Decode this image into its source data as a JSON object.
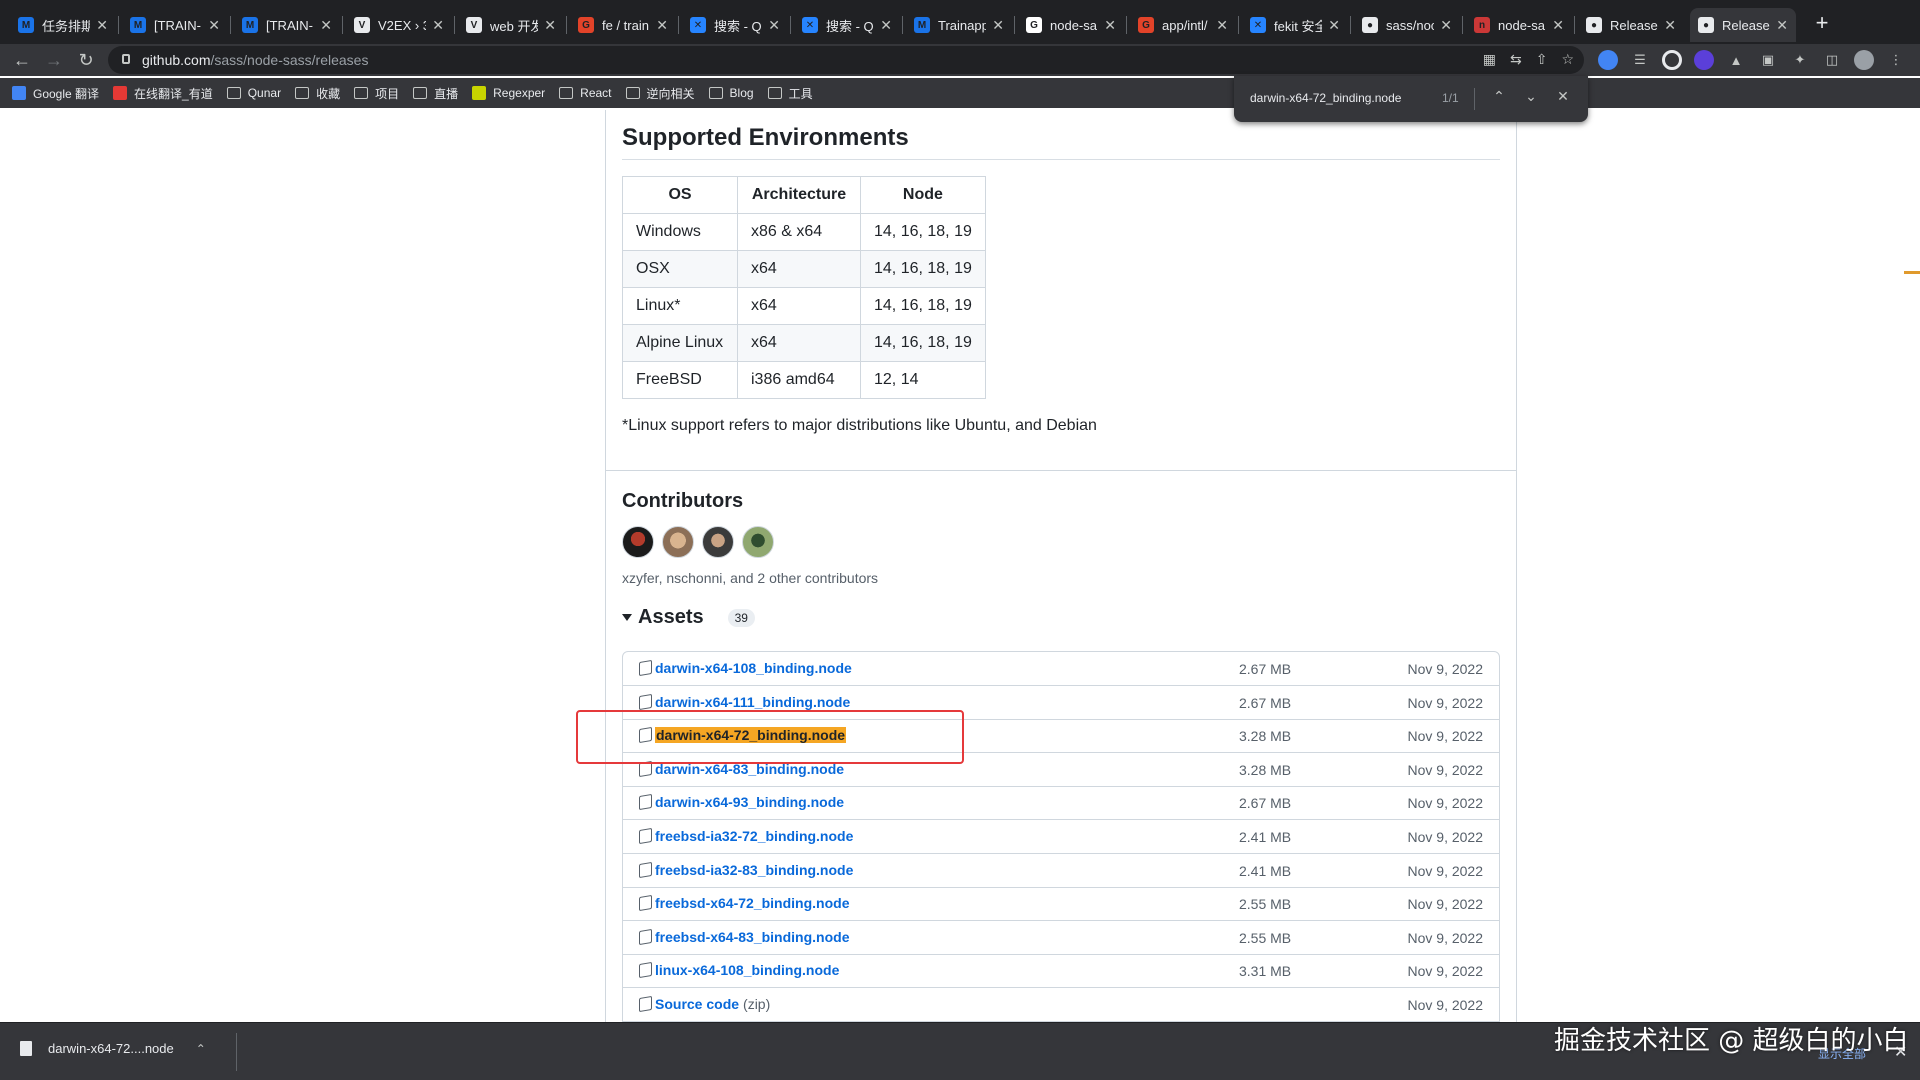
{
  "browser": {
    "tabs": [
      {
        "title": "任务排期",
        "color": "#1a73e8",
        "glyph": "M"
      },
      {
        "title": "[TRAIN-",
        "color": "#1a73e8",
        "glyph": "M"
      },
      {
        "title": "[TRAIN-",
        "color": "#1a73e8",
        "glyph": "M"
      },
      {
        "title": "V2EX › 3",
        "color": "#e8eaed",
        "glyph": "V"
      },
      {
        "title": "web 开发",
        "color": "#e8eaed",
        "glyph": "V"
      },
      {
        "title": "fe / train",
        "color": "#e24329",
        "glyph": "G"
      },
      {
        "title": "搜索 - Q",
        "color": "#2684ff",
        "glyph": "✕"
      },
      {
        "title": "搜索 - Q",
        "color": "#2684ff",
        "glyph": "✕"
      },
      {
        "title": "Trainapp",
        "color": "#1a73e8",
        "glyph": "M"
      },
      {
        "title": "node-sa",
        "color": "#ffffff",
        "glyph": "G"
      },
      {
        "title": "app/intl/",
        "color": "#e24329",
        "glyph": "G"
      },
      {
        "title": "fekit 安全",
        "color": "#2684ff",
        "glyph": "✕"
      },
      {
        "title": "sass/noc",
        "color": "#e8eaed",
        "glyph": "●"
      },
      {
        "title": "node-sa",
        "color": "#cb3837",
        "glyph": "n"
      },
      {
        "title": "Release",
        "color": "#e8eaed",
        "glyph": "●"
      },
      {
        "title": "Release",
        "color": "#e8eaed",
        "glyph": "●"
      }
    ],
    "url_host": "github.com",
    "url_path": "/sass/node-sass/releases",
    "bookmarks": [
      "Google 翻译",
      "在线翻译_有道",
      "Qunar",
      "收藏",
      "项目",
      "直播",
      "Regexper",
      "React",
      "逆向相关",
      "Blog",
      "工具"
    ],
    "find_query": "darwin-x64-72_binding.node",
    "find_count": "1/1"
  },
  "supported": {
    "title": "Supported Environments",
    "headers": [
      "OS",
      "Architecture",
      "Node"
    ],
    "rows": [
      [
        "Windows",
        "x86 & x64",
        "14, 16, 18, 19"
      ],
      [
        "OSX",
        "x64",
        "14, 16, 18, 19"
      ],
      [
        "Linux*",
        "x64",
        "14, 16, 18, 19"
      ],
      [
        "Alpine Linux",
        "x64",
        "14, 16, 18, 19"
      ],
      [
        "FreeBSD",
        "i386 amd64",
        "12, 14"
      ]
    ],
    "note": "*Linux support refers to major distributions like Ubuntu, and Debian"
  },
  "contributors": {
    "title": "Contributors",
    "text": "xzyfer, nschonni, and 2 other contributors"
  },
  "assets": {
    "title": "Assets",
    "count": "39",
    "items": [
      {
        "name": "darwin-x64-108_binding.node",
        "size": "2.67 MB",
        "date": "Nov 9, 2022"
      },
      {
        "name": "darwin-x64-111_binding.node",
        "size": "2.67 MB",
        "date": "Nov 9, 2022"
      },
      {
        "name": "darwin-x64-72_binding.node",
        "size": "3.28 MB",
        "date": "Nov 9, 2022",
        "highlight": true
      },
      {
        "name": "darwin-x64-83_binding.node",
        "size": "3.28 MB",
        "date": "Nov 9, 2022"
      },
      {
        "name": "darwin-x64-93_binding.node",
        "size": "2.67 MB",
        "date": "Nov 9, 2022"
      },
      {
        "name": "freebsd-ia32-72_binding.node",
        "size": "2.41 MB",
        "date": "Nov 9, 2022"
      },
      {
        "name": "freebsd-ia32-83_binding.node",
        "size": "2.41 MB",
        "date": "Nov 9, 2022"
      },
      {
        "name": "freebsd-x64-72_binding.node",
        "size": "2.55 MB",
        "date": "Nov 9, 2022"
      },
      {
        "name": "freebsd-x64-83_binding.node",
        "size": "2.55 MB",
        "date": "Nov 9, 2022"
      },
      {
        "name": "linux-x64-108_binding.node",
        "size": "3.31 MB",
        "date": "Nov 9, 2022"
      },
      {
        "name": "Source code",
        "suffix": "(zip)",
        "size": "",
        "date": "Nov 9, 2022"
      }
    ]
  },
  "download": {
    "filename": "darwin-x64-72....node",
    "show_all": "显示全部"
  },
  "watermark": "掘金技术社区 @ 超级白的小白"
}
